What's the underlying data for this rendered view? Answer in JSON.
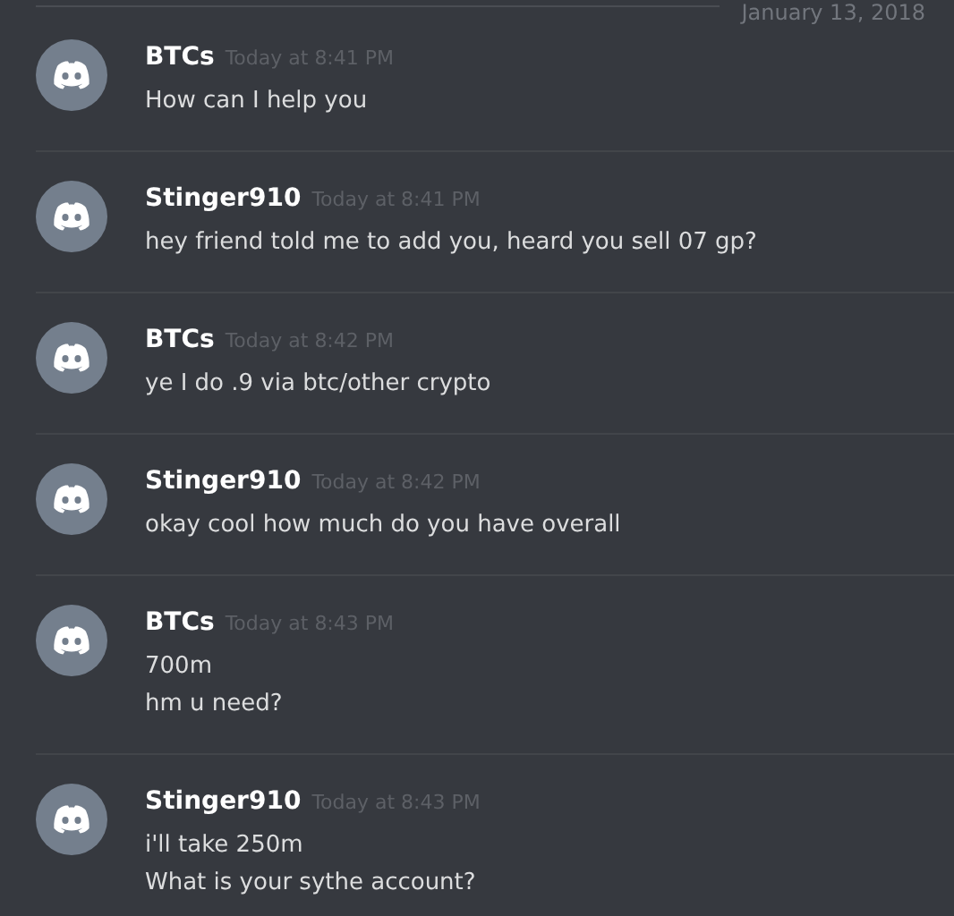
{
  "date_divider": "January 13, 2018",
  "messages": [
    {
      "author": "BTCs",
      "time": "Today at 8:41 PM",
      "lines": [
        "How can I help you"
      ]
    },
    {
      "author": "Stinger910",
      "time": "Today at 8:41 PM",
      "lines": [
        "hey friend told me to add you, heard you sell 07 gp?"
      ]
    },
    {
      "author": "BTCs",
      "time": "Today at 8:42 PM",
      "lines": [
        "ye I do .9 via btc/other crypto"
      ]
    },
    {
      "author": "Stinger910",
      "time": "Today at 8:42 PM",
      "lines": [
        "okay cool how much do you have overall"
      ]
    },
    {
      "author": "BTCs",
      "time": "Today at 8:43 PM",
      "lines": [
        "700m",
        "hm u need?"
      ]
    },
    {
      "author": "Stinger910",
      "time": "Today at 8:43 PM",
      "lines": [
        "i'll take 250m",
        "What is your sythe account?"
      ]
    }
  ]
}
